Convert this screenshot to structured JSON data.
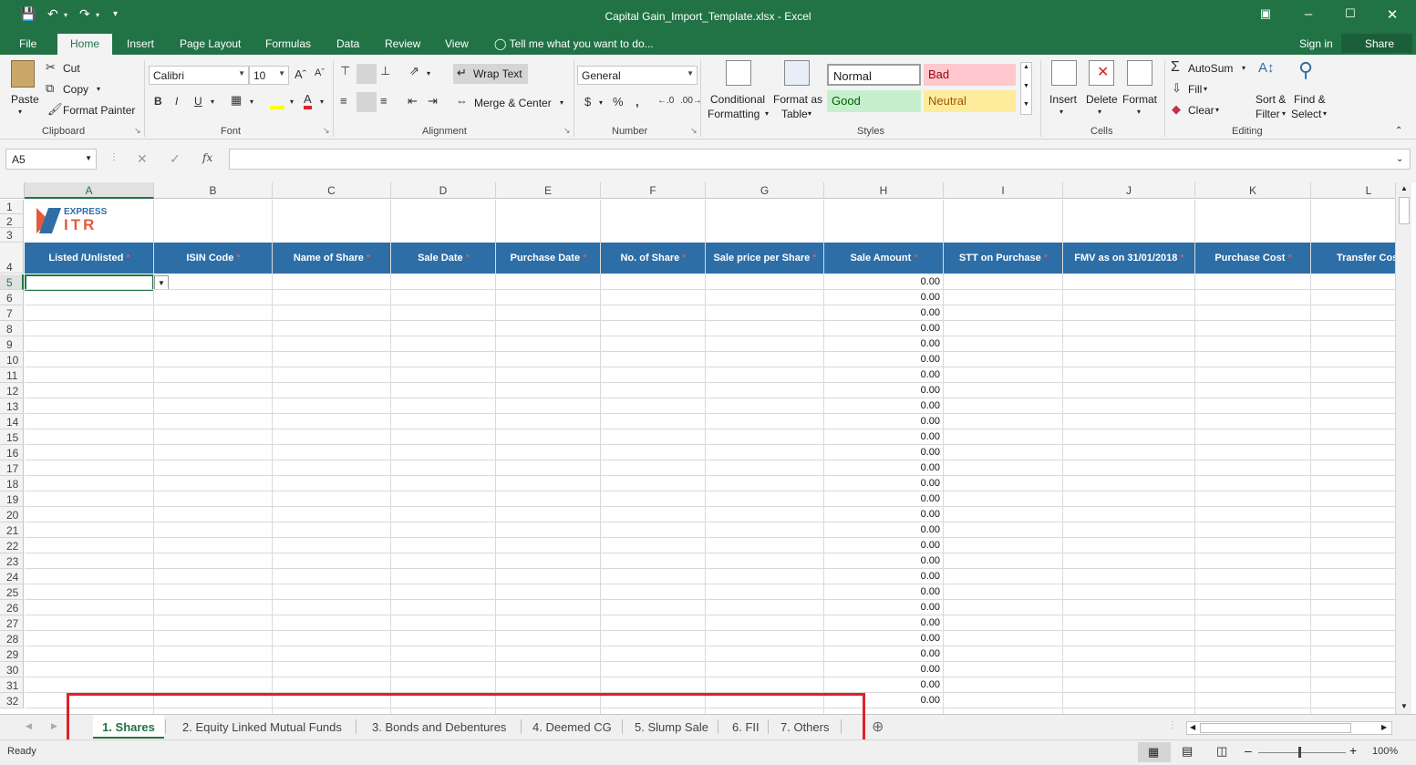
{
  "window": {
    "title": "Capital Gain_Import_Template.xlsx - Excel"
  },
  "ribbon_tabs": [
    "File",
    "Home",
    "Insert",
    "Page Layout",
    "Formulas",
    "Data",
    "Review",
    "View"
  ],
  "active_tab": "Home",
  "tell_me": "Tell me what you want to do...",
  "account": {
    "sign_in": "Sign in",
    "share": "Share"
  },
  "clipboard": {
    "paste": "Paste",
    "cut": "Cut",
    "copy": "Copy",
    "format_painter": "Format Painter",
    "label": "Clipboard"
  },
  "font": {
    "name": "Calibri",
    "size": "10",
    "label": "Font",
    "bold": "B",
    "italic": "I",
    "underline": "U"
  },
  "alignment": {
    "wrap_text": "Wrap Text",
    "merge_center": "Merge & Center",
    "label": "Alignment"
  },
  "number": {
    "format": "General",
    "label": "Number",
    "currency": "$",
    "percent": "%",
    "comma": ","
  },
  "styles": {
    "conditional_formatting": [
      "Conditional",
      "Formatting"
    ],
    "format_as_table": [
      "Format as",
      "Table"
    ],
    "normal": "Normal",
    "bad": "Bad",
    "good": "Good",
    "neutral": "Neutral",
    "label": "Styles",
    "colors": {
      "bad_bg": "#ffc7ce",
      "bad_fg": "#9c0006",
      "good_bg": "#c6efce",
      "good_fg": "#006100",
      "neutral_bg": "#ffeb9c",
      "neutral_fg": "#9c5700"
    }
  },
  "cells": {
    "insert": "Insert",
    "delete": "Delete",
    "format": "Format",
    "label": "Cells"
  },
  "editing": {
    "autosum": "AutoSum",
    "fill": "Fill",
    "clear": "Clear",
    "sort_filter": [
      "Sort &",
      "Filter"
    ],
    "find_select": [
      "Find &",
      "Select"
    ],
    "label": "Editing"
  },
  "formula_bar": {
    "name_box": "A5",
    "fx": "fx",
    "value": ""
  },
  "columns": [
    "A",
    "B",
    "C",
    "D",
    "E",
    "F",
    "G",
    "H",
    "I",
    "J",
    "K",
    "L"
  ],
  "logo": {
    "line1": "EXPRESS",
    "line2": "ITR"
  },
  "headers": [
    "Listed /Unlisted",
    "ISIN Code",
    "Name of Share",
    "Sale Date",
    "Purchase Date",
    "No. of Share",
    "Sale price per Share",
    "Sale Amount",
    "STT on Purchase",
    "FMV as on 31/01/2018",
    "Purchase Cost",
    "Transfer Cost"
  ],
  "required_mark": "*",
  "rows": [
    "1",
    "2",
    "3",
    "4",
    "5",
    "6",
    "7",
    "8",
    "9",
    "10",
    "11",
    "12",
    "13",
    "14",
    "15",
    "16",
    "17",
    "18",
    "19",
    "20",
    "21",
    "22",
    "23",
    "24",
    "25",
    "26",
    "27",
    "28",
    "29",
    "30",
    "31",
    "32"
  ],
  "sale_amount_default": "0.00",
  "sheets": [
    "1. Shares",
    "2. Equity Linked Mutual Funds",
    "3. Bonds and Debentures",
    "4. Deemed CG",
    "5. Slump Sale",
    "6. FII",
    "7. Others"
  ],
  "active_sheet": "1. Shares",
  "status": {
    "ready": "Ready",
    "zoom": "100%"
  },
  "accent": "#217346",
  "header_band_color": "#2e6ea6"
}
